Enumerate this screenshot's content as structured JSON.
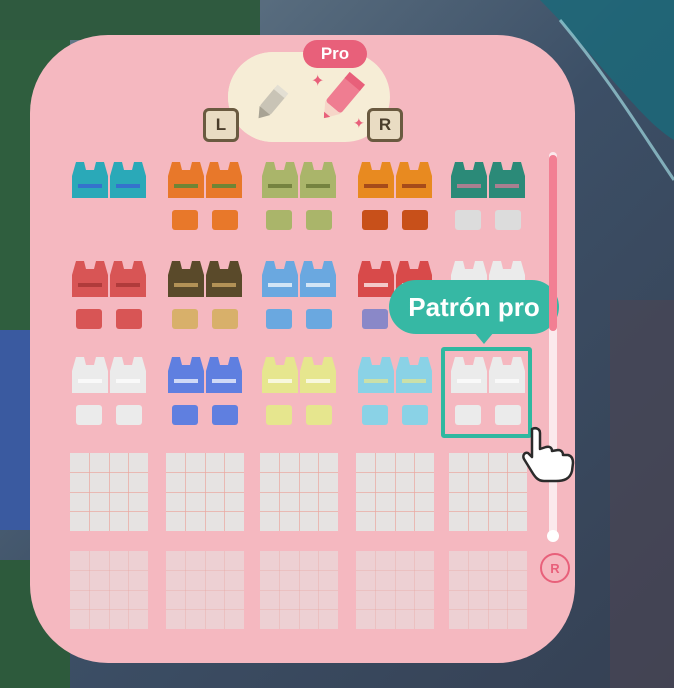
{
  "tabs": {
    "pro_label": "Pro",
    "left_key": "L",
    "right_key": "R",
    "tool_icons": [
      "pencil-icon",
      "pro-pencil-icon"
    ]
  },
  "tooltip": {
    "label": "Patrón pro"
  },
  "scroll": {
    "stick_label": "R"
  },
  "designs": [
    {
      "name": "blue-gradient-tank",
      "top": "#2aa9b8",
      "accent": "#3b5bd6",
      "legs": null
    },
    {
      "name": "orange-tank-eyes",
      "top": "#e8782a",
      "accent": "#3b8a3b",
      "legs": "#e8782a"
    },
    {
      "name": "green-striped-vest",
      "top": "#aab56a",
      "accent": "#5e6e2d",
      "legs": "#aab56a"
    },
    {
      "name": "orange-fringe-tank",
      "top": "#e88a20",
      "accent": "#8a3018",
      "legs": "#c8501a"
    },
    {
      "name": "teal-heart-tank",
      "top": "#2b8a78",
      "accent": "#e07a9a",
      "legs": "#dcdcdc"
    },
    {
      "name": "red-button-vest",
      "top": "#d85555",
      "accent": "#a03030",
      "legs": "#d85555"
    },
    {
      "name": "brown-dotted-vest",
      "top": "#5a4a2a",
      "accent": "#d8b06a",
      "legs": "#d8b06a"
    },
    {
      "name": "blue-knit-tank",
      "top": "#6aa8e0",
      "accent": "#ffffff",
      "legs": "#6aa8e0"
    },
    {
      "name": "red-striped-hat",
      "top": "#d84a4a",
      "accent": "#ffffff",
      "legs": "#8a88c8"
    },
    {
      "name": "white-blank-tank",
      "top": "#ebebeb",
      "accent": "#ffffff",
      "legs": "#ebebeb"
    },
    {
      "name": "white-template",
      "top": "#ebebeb",
      "accent": "#ffffff",
      "legs": "#ebebeb"
    },
    {
      "name": "blue-template",
      "top": "#5f7fe0",
      "accent": "#ffffff",
      "legs": "#5f7fe0"
    },
    {
      "name": "yellow-template",
      "top": "#e6e68e",
      "accent": "#ffffff",
      "legs": "#e6e68e"
    },
    {
      "name": "sky-template",
      "top": "#8ad2e6",
      "accent": "#e6e68e",
      "legs": "#8ad2e6"
    },
    {
      "name": "white-selected-template",
      "top": "#ebebeb",
      "accent": "#ffffff",
      "legs": "#ebebeb"
    }
  ],
  "colors": {
    "panel": "#f5b8c0",
    "selection": "#2fb8a0",
    "tooltip": "#36b8a4",
    "scroll_thumb": "#f27f93",
    "background_water": "#2a4a6a",
    "background_ground": "#2a6040"
  }
}
